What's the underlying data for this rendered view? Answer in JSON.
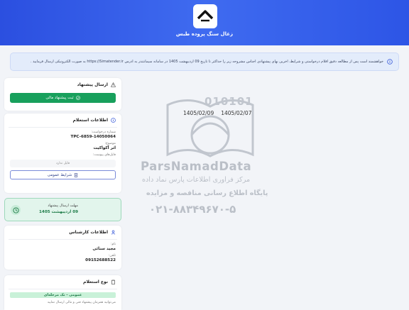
{
  "header": {
    "company_name": "زغال سنگ پروده طبس"
  },
  "notice": {
    "text": "خواهشمند است پس از مطالعه دقیق اقلام درخواستی و شرایط، آخرین بهای پیشنهادی اجناس مشروحه زیر را حداکثر تا تاریخ 09 اردیبهشت 1405 در سامانه سیمانتندر به آدرس https://Simatender.ir به صورت الکترونیکی ارسال فرمایید ."
  },
  "send_offer": {
    "title": "ارسال پیشنهاد",
    "button_label": "ثبت پیشنهاد مالی"
  },
  "inquiry_info": {
    "title": "اطلاعات استعلام",
    "request_number_label": "شماره درخواست:",
    "request_number": "TPC-6859-14050064",
    "subject_label": "موضوع:",
    "subject": "اثر آکواکیت",
    "attachments_label": "فایل‌های پیوست:",
    "attachments_empty": "فایل ندارد",
    "general_terms_button": "شرایط عمومی"
  },
  "deadline": {
    "label": "مهلت ارسال پیشنهاد",
    "value": "09 اردیبهشت 1405"
  },
  "expert_info": {
    "title": "اطلاعات کارشناس",
    "name_label": "نام:",
    "name": "مجید سنائی",
    "phone_label": "تلفن:",
    "phone": "09152688522"
  },
  "inquiry_type": {
    "title": "نوع استعلام",
    "badge": "عمومی - تک مرحله‌ای",
    "description": "می‌توانید همزمان پیشنهاد فنی و مالی ارسال نمایید"
  },
  "dates": {
    "start": "1405/02/07",
    "end": "1405/02/09"
  },
  "watermark": {
    "brand": "ParsNamadData",
    "line1": "مرکز فراوری اطلاعات پارس نماد داده",
    "line2": "پایگاه اطلاع رسانی مناقصه و مزایده",
    "phone": "۰۲۱-۸۸۳۴۹۶۷۰-۵",
    "digits": "010101"
  },
  "colors": {
    "header": "#2d55e6",
    "accent_green": "#18a05c",
    "notice_bg": "#e3ecfb"
  }
}
